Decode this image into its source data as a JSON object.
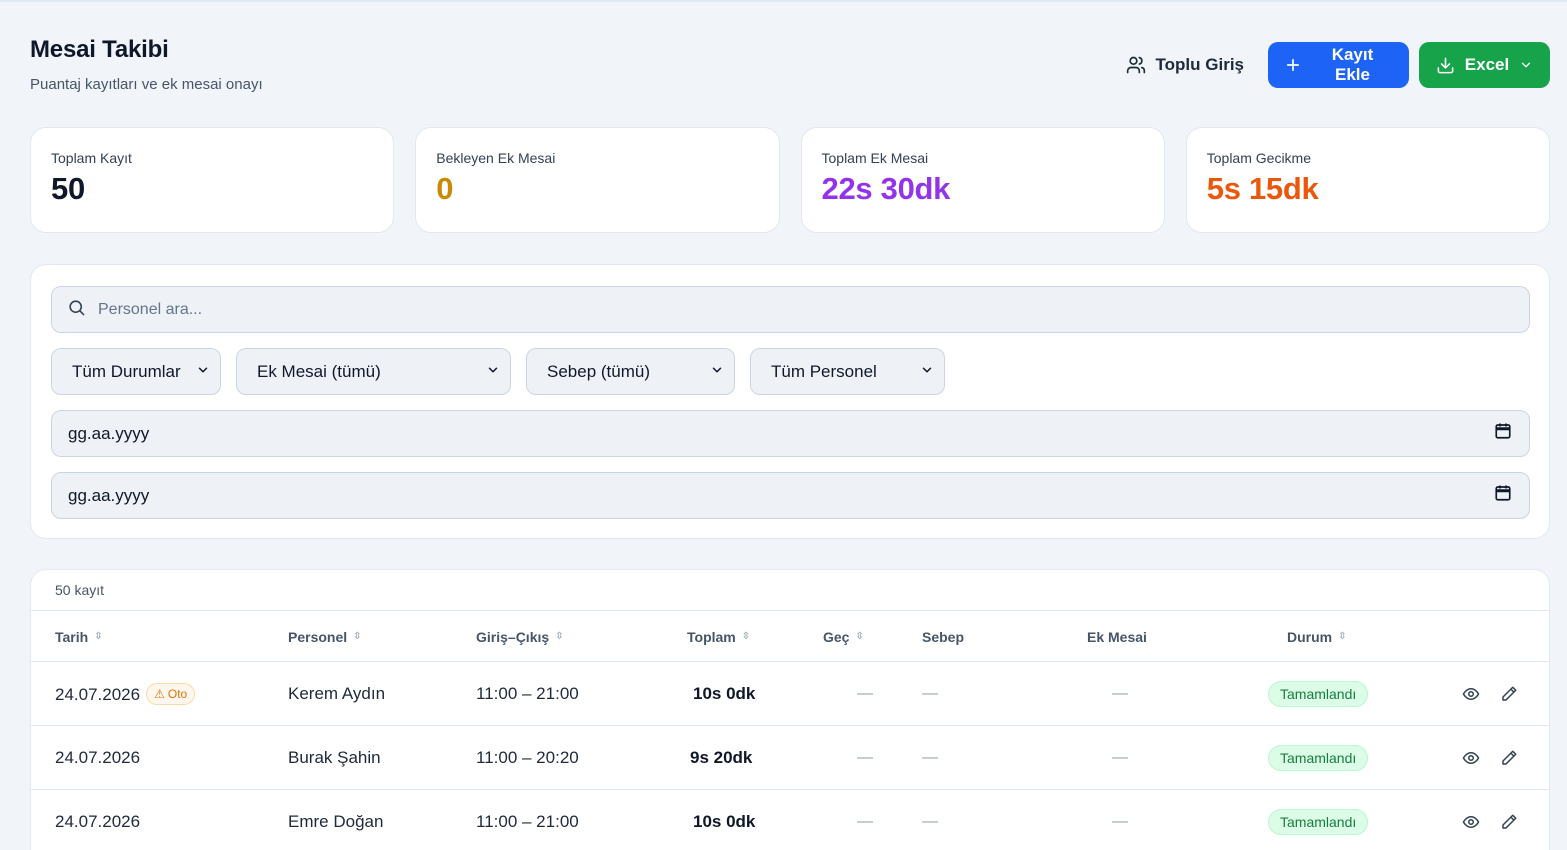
{
  "header": {
    "title": "Mesai Takibi",
    "subtitle": "Puantaj kayıtları ve ek mesai onayı"
  },
  "actions": {
    "bulk_label": "Toplu Giriş",
    "add_label": "Kayıt Ekle",
    "excel_label": "Excel"
  },
  "stats": [
    {
      "label": "Toplam Kayıt",
      "value": "50",
      "color": "#0f172a"
    },
    {
      "label": "Bekleyen Ek Mesai",
      "value": "0",
      "color": "#ca8a04"
    },
    {
      "label": "Toplam Ek Mesai",
      "value": "22s 30dk",
      "color": "#9333ea"
    },
    {
      "label": "Toplam Gecikme",
      "value": "5s 15dk",
      "color": "#ea580c"
    }
  ],
  "filters": {
    "search_placeholder": "Personel ara...",
    "status": "Tüm Durumlar",
    "overtime": "Ek Mesai (tümü)",
    "reason": "Sebep (tümü)",
    "staff": "Tüm Personel",
    "date_from": "gg.aa.yyyy",
    "date_to": "gg.aa.yyyy"
  },
  "table": {
    "count": "50 kayıt",
    "columns": {
      "date": "Tarih",
      "staff": "Personel",
      "inout": "Giriş–Çıkış",
      "total": "Toplam",
      "late": "Geç",
      "reason": "Sebep",
      "overtime": "Ek Mesai",
      "status": "Durum"
    },
    "rows": [
      {
        "date": "24.07.2026",
        "auto": "Oto",
        "staff": "Kerem Aydın",
        "inout": "11:00 – 21:00",
        "total": "10s 0dk",
        "late": "—",
        "reason": "—",
        "overtime": "—",
        "status": "Tamamlandı"
      },
      {
        "date": "24.07.2026",
        "auto": "",
        "staff": "Burak Şahin",
        "inout": "11:00 – 20:20",
        "total": "9s 20dk",
        "late": "—",
        "reason": "—",
        "overtime": "—",
        "status": "Tamamlandı"
      },
      {
        "date": "24.07.2026",
        "auto": "",
        "staff": "Emre Doğan",
        "inout": "11:00 – 21:00",
        "total": "10s 0dk",
        "late": "—",
        "reason": "—",
        "overtime": "—",
        "status": "Tamamlandı"
      }
    ]
  },
  "colors": {
    "primary": "#1d63f5",
    "success": "#16a34a",
    "badge_green": "#15803d"
  }
}
